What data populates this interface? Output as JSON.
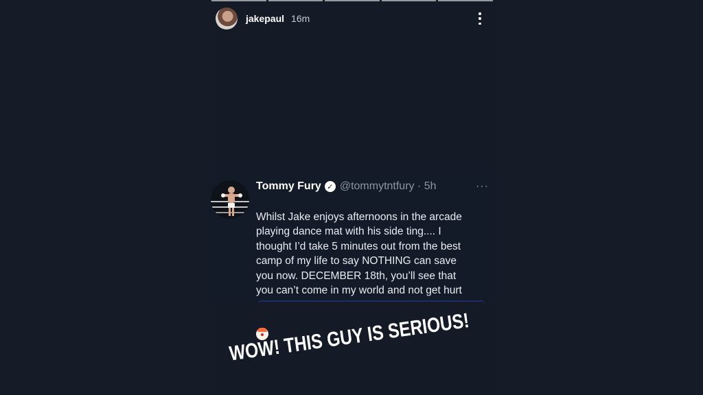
{
  "story": {
    "segments": 5,
    "username": "jakepaul",
    "time": "16m",
    "caption": "WOW! THIS GUY IS SERIOUS!"
  },
  "tweet": {
    "name": "Tommy Fury",
    "verified_mark": "✓",
    "handle": "@tommytntfury · 5h",
    "more": "···",
    "text": "Whilst Jake enjoys afternoons in the arcade\nplaying dance mat with his side ting.... I\nthought I’d take 5 minutes out from the best\ncamp of my life to say NOTHING can save\nyou now. DECEMBER 18th, you’ll see that\nyou can’t come in my world and not get hurt",
    "emoji_icon": "clown-face-icon"
  },
  "colors": {
    "background": "#161c27",
    "text": "#ffffff",
    "muted": "#8b95a3",
    "media_border": "#1d2c6c"
  }
}
